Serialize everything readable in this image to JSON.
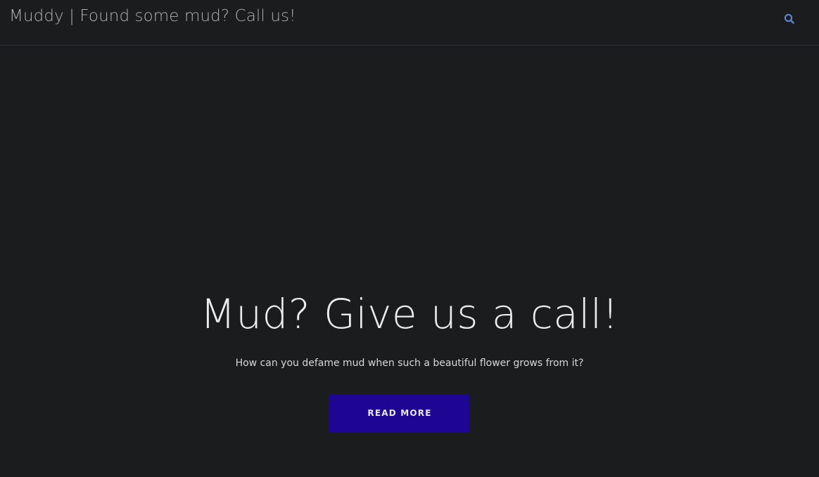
{
  "header": {
    "site_title": "Muddy | Found some mud? Call us!",
    "search_icon": "search-icon",
    "search_icon_color": "#5b86c4"
  },
  "hero": {
    "title": "Mud? Give us a call!",
    "subtitle": "How can you defame mud when such a beautiful flower grows from it?",
    "button_label": "READ MORE",
    "button_color": "#1f0594"
  },
  "colors": {
    "background": "#1b1c1e",
    "title_text": "#b0b0b0",
    "hero_text": "#ececec"
  }
}
